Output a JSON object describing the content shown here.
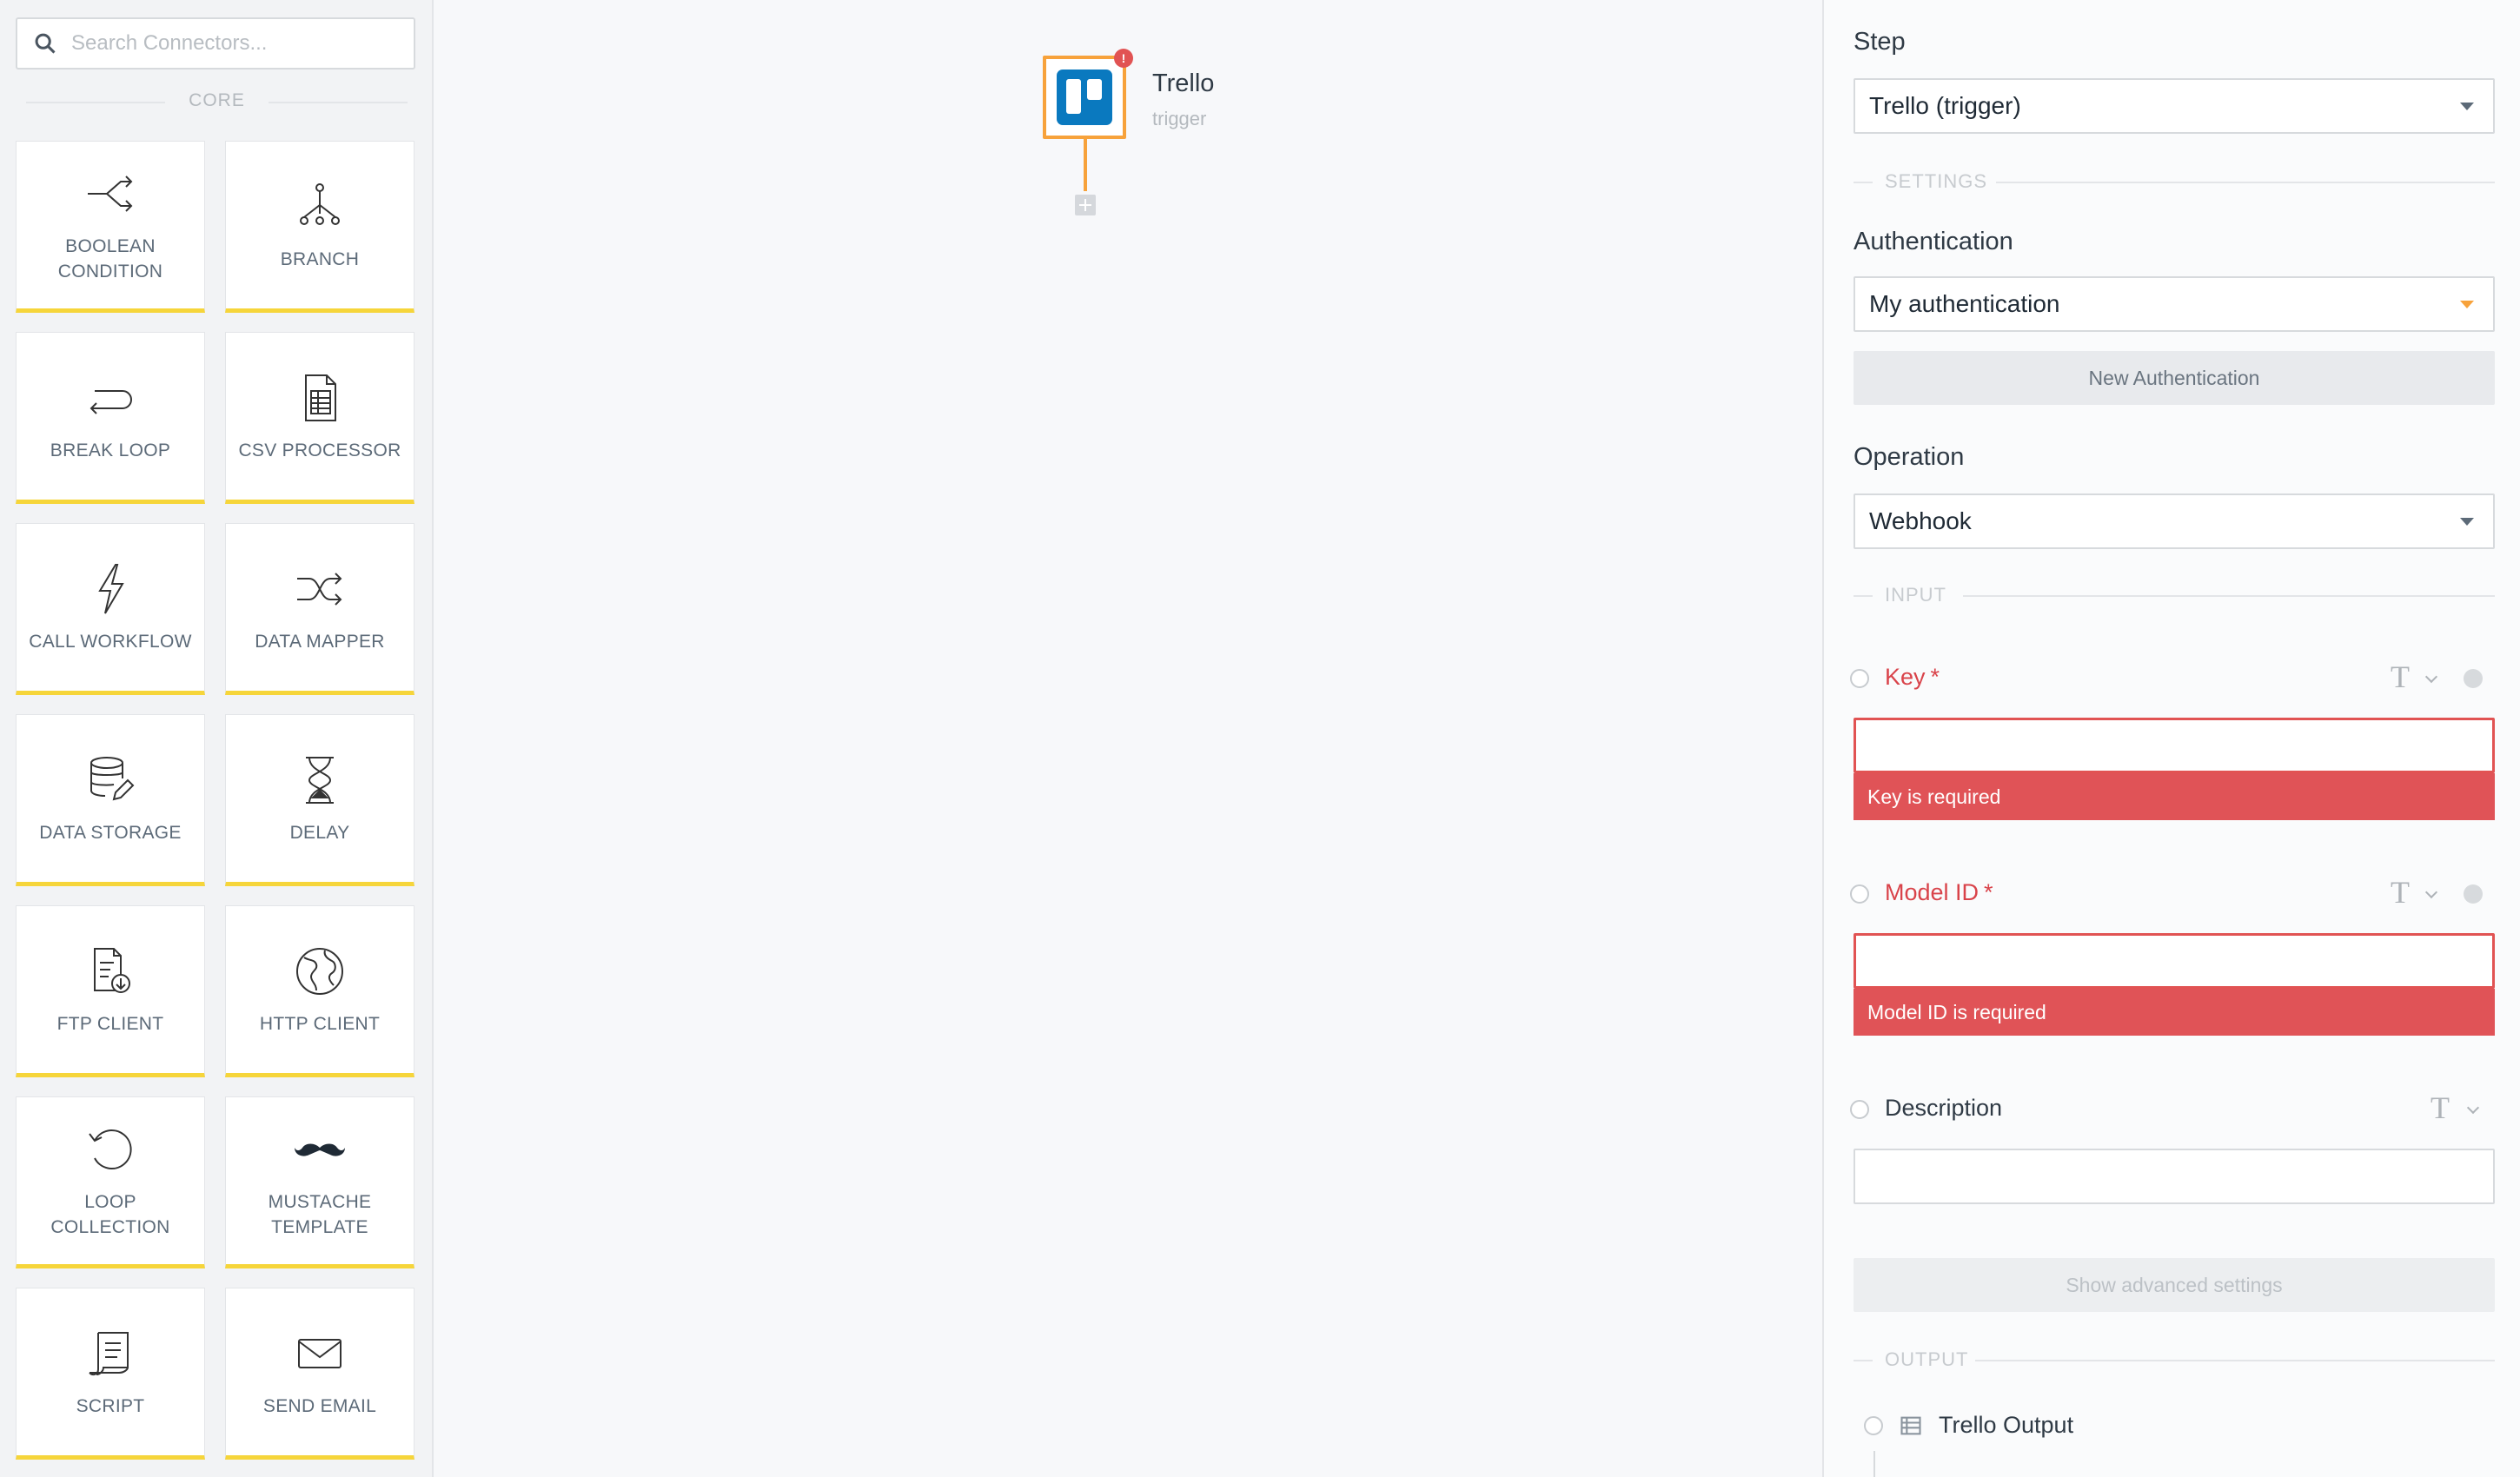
{
  "search": {
    "placeholder": "Search Connectors..."
  },
  "sidebar": {
    "section_label": "CORE",
    "tiles": [
      {
        "label": "BOOLEAN\nCONDITION",
        "icon": "boolean-condition-icon"
      },
      {
        "label": "BRANCH",
        "icon": "branch-icon"
      },
      {
        "label": "BREAK LOOP",
        "icon": "break-loop-icon"
      },
      {
        "label": "CSV PROCESSOR",
        "icon": "csv-processor-icon"
      },
      {
        "label": "CALL WORKFLOW",
        "icon": "call-workflow-icon"
      },
      {
        "label": "DATA MAPPER",
        "icon": "data-mapper-icon"
      },
      {
        "label": "DATA STORAGE",
        "icon": "data-storage-icon"
      },
      {
        "label": "DELAY",
        "icon": "delay-icon"
      },
      {
        "label": "FTP CLIENT",
        "icon": "ftp-client-icon"
      },
      {
        "label": "HTTP CLIENT",
        "icon": "http-client-icon"
      },
      {
        "label": "LOOP\nCOLLECTION",
        "icon": "loop-collection-icon"
      },
      {
        "label": "MUSTACHE\nTEMPLATE",
        "icon": "mustache-template-icon"
      },
      {
        "label": "SCRIPT",
        "icon": "script-icon"
      },
      {
        "label": "SEND EMAIL",
        "icon": "send-email-icon"
      }
    ]
  },
  "canvas": {
    "node": {
      "title": "Trello",
      "subtitle": "trigger",
      "badge": "!"
    }
  },
  "panel": {
    "step_label": "Step",
    "step_value": "Trello (trigger)",
    "settings_section": "SETTINGS",
    "auth_label": "Authentication",
    "auth_value": "My authentication",
    "new_auth_button": "New Authentication",
    "operation_label": "Operation",
    "operation_value": "Webhook",
    "input_section": "INPUT",
    "fields": [
      {
        "label": "Key",
        "required": "*",
        "error": "Key is required",
        "type_icon": "T"
      },
      {
        "label": "Model ID",
        "required": "*",
        "error": "Model ID is required",
        "type_icon": "T"
      },
      {
        "label": "Description",
        "type_icon": "T"
      }
    ],
    "advanced_button": "Show advanced settings",
    "output_section": "OUTPUT",
    "output_label": "Trello Output"
  },
  "colors": {
    "accent": "#f7a23b",
    "tile_border": "#f6d53a",
    "error": "#e05357",
    "trello_blue": "#0a79bf"
  }
}
